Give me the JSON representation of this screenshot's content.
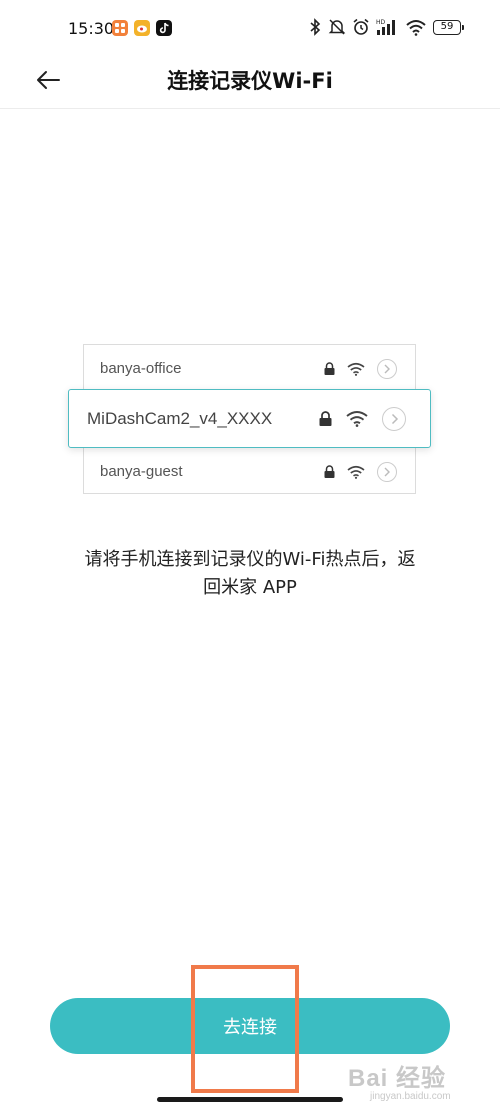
{
  "status_bar": {
    "time": "15:30",
    "battery": "59",
    "app_icons": [
      "orange-app-icon",
      "weibo-icon",
      "tiktok-icon"
    ],
    "system_icons": [
      "bluetooth-icon",
      "mute-icon",
      "alarm-icon",
      "signal-hd-icon",
      "wifi-icon",
      "battery-icon"
    ]
  },
  "header": {
    "title": "连接记录仪Wi-Fi",
    "back_icon": "back-arrow-icon"
  },
  "illustration": {
    "networks": [
      {
        "ssid": "banya-office",
        "highlighted": false
      },
      {
        "ssid": "MiDashCam2_v4_XXXX",
        "highlighted": true
      },
      {
        "ssid": "banya-guest",
        "highlighted": false
      }
    ],
    "accent_color": "#4fbcc2"
  },
  "instruction": {
    "line1": "请将手机连接到记录仪的Wi-Fi热点后，返",
    "line2": "回米家 APP"
  },
  "actions": {
    "connect_label": "去连接",
    "button_color": "#3bbdc2"
  },
  "annotation": {
    "box_color": "#f07a4a"
  },
  "watermark": {
    "main": "Bai 经验",
    "sub": "jingyan.baidu.com"
  }
}
